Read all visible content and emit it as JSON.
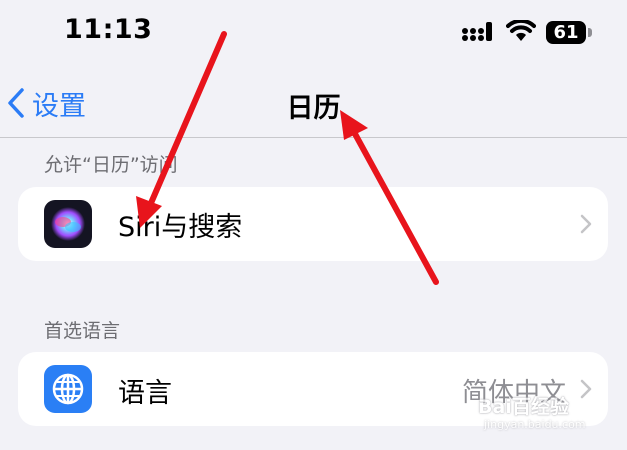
{
  "status_bar": {
    "time": "11:13",
    "battery_level": "61",
    "icons": [
      "signal-icon",
      "wifi-icon",
      "battery-icon"
    ]
  },
  "nav": {
    "back_label": "设置",
    "title": "日历"
  },
  "sections": [
    {
      "header": "允许“日历”访问",
      "rows": [
        {
          "icon": "siri-icon",
          "label": "Siri与搜索",
          "value": ""
        }
      ]
    },
    {
      "header": "首选语言",
      "rows": [
        {
          "icon": "globe-icon",
          "label": "语言",
          "value": "简体中文"
        }
      ]
    }
  ],
  "watermark": {
    "brand": "Bai百经验",
    "url": "jingyan.baidu.com"
  },
  "colors": {
    "accent": "#2b7cf6",
    "background": "#f2f2f7",
    "annotation_arrow": "#e8141c"
  }
}
